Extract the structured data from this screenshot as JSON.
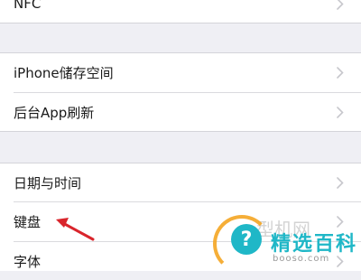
{
  "rows": {
    "nfc": "NFC",
    "iphone_storage": "iPhone储存空间",
    "background_refresh": "后台App刷新",
    "date_time": "日期与时间",
    "keyboard": "键盘",
    "fonts": "字体"
  },
  "watermark": {
    "faint_text": "型机网",
    "title": "精选百科",
    "subtitle": "booso.com",
    "icon_glyph": "?"
  },
  "colors": {
    "background": "#efeff4",
    "cell": "#ffffff",
    "chevron": "#c7c7cc",
    "arrow": "#d9252c",
    "watermark_accent": "#1fb7c7"
  },
  "icons": {
    "chevron": "chevron-right-icon",
    "annotation": "arrow-annotation-icon"
  }
}
